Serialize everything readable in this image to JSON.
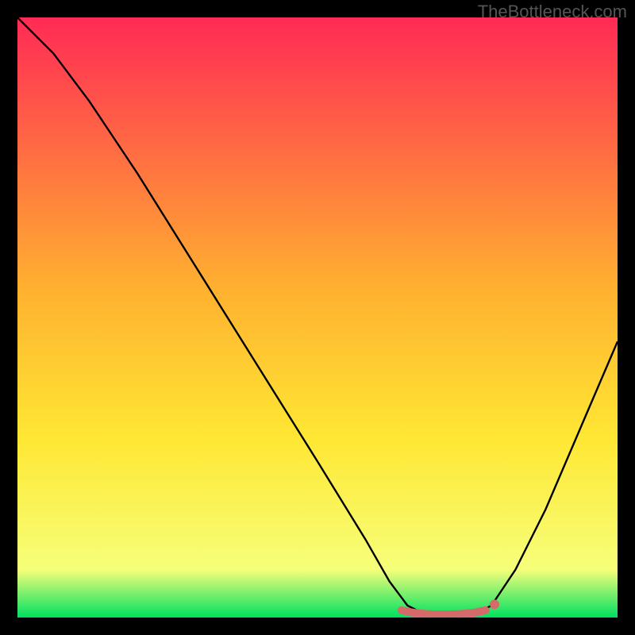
{
  "watermark": "TheBottleneck.com",
  "chart_data": {
    "type": "line",
    "title": "",
    "xlabel": "",
    "ylabel": "",
    "xlim": [
      0,
      100
    ],
    "ylim": [
      0,
      100
    ],
    "background_gradient": {
      "top": "#ff2a55",
      "mid1": "#ffb030",
      "mid2": "#ffe733",
      "mid3": "#f6ff7a",
      "bottom": "#00e060"
    },
    "series": [
      {
        "name": "bottleneck-curve",
        "color": "#000000",
        "points": [
          {
            "x": 0,
            "y": 100
          },
          {
            "x": 6,
            "y": 94
          },
          {
            "x": 12,
            "y": 86
          },
          {
            "x": 20,
            "y": 74
          },
          {
            "x": 30,
            "y": 58
          },
          {
            "x": 40,
            "y": 42
          },
          {
            "x": 50,
            "y": 26
          },
          {
            "x": 58,
            "y": 13
          },
          {
            "x": 62,
            "y": 6
          },
          {
            "x": 65,
            "y": 2
          },
          {
            "x": 68,
            "y": 0.5
          },
          {
            "x": 72,
            "y": 0.3
          },
          {
            "x": 76,
            "y": 0.5
          },
          {
            "x": 79,
            "y": 2
          },
          {
            "x": 83,
            "y": 8
          },
          {
            "x": 88,
            "y": 18
          },
          {
            "x": 94,
            "y": 32
          },
          {
            "x": 100,
            "y": 46
          }
        ]
      },
      {
        "name": "optimal-band",
        "color": "#d46a6a",
        "points": [
          {
            "x": 64,
            "y": 1.2
          },
          {
            "x": 66,
            "y": 0.8
          },
          {
            "x": 68,
            "y": 0.6
          },
          {
            "x": 70,
            "y": 0.5
          },
          {
            "x": 72,
            "y": 0.5
          },
          {
            "x": 74,
            "y": 0.6
          },
          {
            "x": 76,
            "y": 0.8
          },
          {
            "x": 78,
            "y": 1.2
          }
        ],
        "endpoint_dot": {
          "x": 79.5,
          "y": 2.2
        }
      }
    ]
  }
}
